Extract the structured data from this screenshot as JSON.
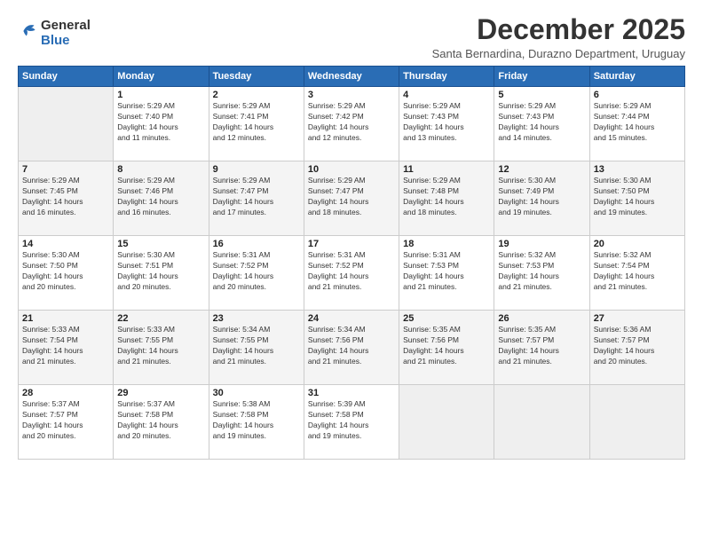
{
  "logo": {
    "general": "General",
    "blue": "Blue"
  },
  "title": "December 2025",
  "subtitle": "Santa Bernardina, Durazno Department, Uruguay",
  "days_of_week": [
    "Sunday",
    "Monday",
    "Tuesday",
    "Wednesday",
    "Thursday",
    "Friday",
    "Saturday"
  ],
  "weeks": [
    [
      {
        "num": "",
        "info": ""
      },
      {
        "num": "1",
        "info": "Sunrise: 5:29 AM\nSunset: 7:40 PM\nDaylight: 14 hours\nand 11 minutes."
      },
      {
        "num": "2",
        "info": "Sunrise: 5:29 AM\nSunset: 7:41 PM\nDaylight: 14 hours\nand 12 minutes."
      },
      {
        "num": "3",
        "info": "Sunrise: 5:29 AM\nSunset: 7:42 PM\nDaylight: 14 hours\nand 12 minutes."
      },
      {
        "num": "4",
        "info": "Sunrise: 5:29 AM\nSunset: 7:43 PM\nDaylight: 14 hours\nand 13 minutes."
      },
      {
        "num": "5",
        "info": "Sunrise: 5:29 AM\nSunset: 7:43 PM\nDaylight: 14 hours\nand 14 minutes."
      },
      {
        "num": "6",
        "info": "Sunrise: 5:29 AM\nSunset: 7:44 PM\nDaylight: 14 hours\nand 15 minutes."
      }
    ],
    [
      {
        "num": "7",
        "info": "Sunrise: 5:29 AM\nSunset: 7:45 PM\nDaylight: 14 hours\nand 16 minutes."
      },
      {
        "num": "8",
        "info": "Sunrise: 5:29 AM\nSunset: 7:46 PM\nDaylight: 14 hours\nand 16 minutes."
      },
      {
        "num": "9",
        "info": "Sunrise: 5:29 AM\nSunset: 7:47 PM\nDaylight: 14 hours\nand 17 minutes."
      },
      {
        "num": "10",
        "info": "Sunrise: 5:29 AM\nSunset: 7:47 PM\nDaylight: 14 hours\nand 18 minutes."
      },
      {
        "num": "11",
        "info": "Sunrise: 5:29 AM\nSunset: 7:48 PM\nDaylight: 14 hours\nand 18 minutes."
      },
      {
        "num": "12",
        "info": "Sunrise: 5:30 AM\nSunset: 7:49 PM\nDaylight: 14 hours\nand 19 minutes."
      },
      {
        "num": "13",
        "info": "Sunrise: 5:30 AM\nSunset: 7:50 PM\nDaylight: 14 hours\nand 19 minutes."
      }
    ],
    [
      {
        "num": "14",
        "info": "Sunrise: 5:30 AM\nSunset: 7:50 PM\nDaylight: 14 hours\nand 20 minutes."
      },
      {
        "num": "15",
        "info": "Sunrise: 5:30 AM\nSunset: 7:51 PM\nDaylight: 14 hours\nand 20 minutes."
      },
      {
        "num": "16",
        "info": "Sunrise: 5:31 AM\nSunset: 7:52 PM\nDaylight: 14 hours\nand 20 minutes."
      },
      {
        "num": "17",
        "info": "Sunrise: 5:31 AM\nSunset: 7:52 PM\nDaylight: 14 hours\nand 21 minutes."
      },
      {
        "num": "18",
        "info": "Sunrise: 5:31 AM\nSunset: 7:53 PM\nDaylight: 14 hours\nand 21 minutes."
      },
      {
        "num": "19",
        "info": "Sunrise: 5:32 AM\nSunset: 7:53 PM\nDaylight: 14 hours\nand 21 minutes."
      },
      {
        "num": "20",
        "info": "Sunrise: 5:32 AM\nSunset: 7:54 PM\nDaylight: 14 hours\nand 21 minutes."
      }
    ],
    [
      {
        "num": "21",
        "info": "Sunrise: 5:33 AM\nSunset: 7:54 PM\nDaylight: 14 hours\nand 21 minutes."
      },
      {
        "num": "22",
        "info": "Sunrise: 5:33 AM\nSunset: 7:55 PM\nDaylight: 14 hours\nand 21 minutes."
      },
      {
        "num": "23",
        "info": "Sunrise: 5:34 AM\nSunset: 7:55 PM\nDaylight: 14 hours\nand 21 minutes."
      },
      {
        "num": "24",
        "info": "Sunrise: 5:34 AM\nSunset: 7:56 PM\nDaylight: 14 hours\nand 21 minutes."
      },
      {
        "num": "25",
        "info": "Sunrise: 5:35 AM\nSunset: 7:56 PM\nDaylight: 14 hours\nand 21 minutes."
      },
      {
        "num": "26",
        "info": "Sunrise: 5:35 AM\nSunset: 7:57 PM\nDaylight: 14 hours\nand 21 minutes."
      },
      {
        "num": "27",
        "info": "Sunrise: 5:36 AM\nSunset: 7:57 PM\nDaylight: 14 hours\nand 20 minutes."
      }
    ],
    [
      {
        "num": "28",
        "info": "Sunrise: 5:37 AM\nSunset: 7:57 PM\nDaylight: 14 hours\nand 20 minutes."
      },
      {
        "num": "29",
        "info": "Sunrise: 5:37 AM\nSunset: 7:58 PM\nDaylight: 14 hours\nand 20 minutes."
      },
      {
        "num": "30",
        "info": "Sunrise: 5:38 AM\nSunset: 7:58 PM\nDaylight: 14 hours\nand 19 minutes."
      },
      {
        "num": "31",
        "info": "Sunrise: 5:39 AM\nSunset: 7:58 PM\nDaylight: 14 hours\nand 19 minutes."
      },
      {
        "num": "",
        "info": ""
      },
      {
        "num": "",
        "info": ""
      },
      {
        "num": "",
        "info": ""
      }
    ]
  ]
}
